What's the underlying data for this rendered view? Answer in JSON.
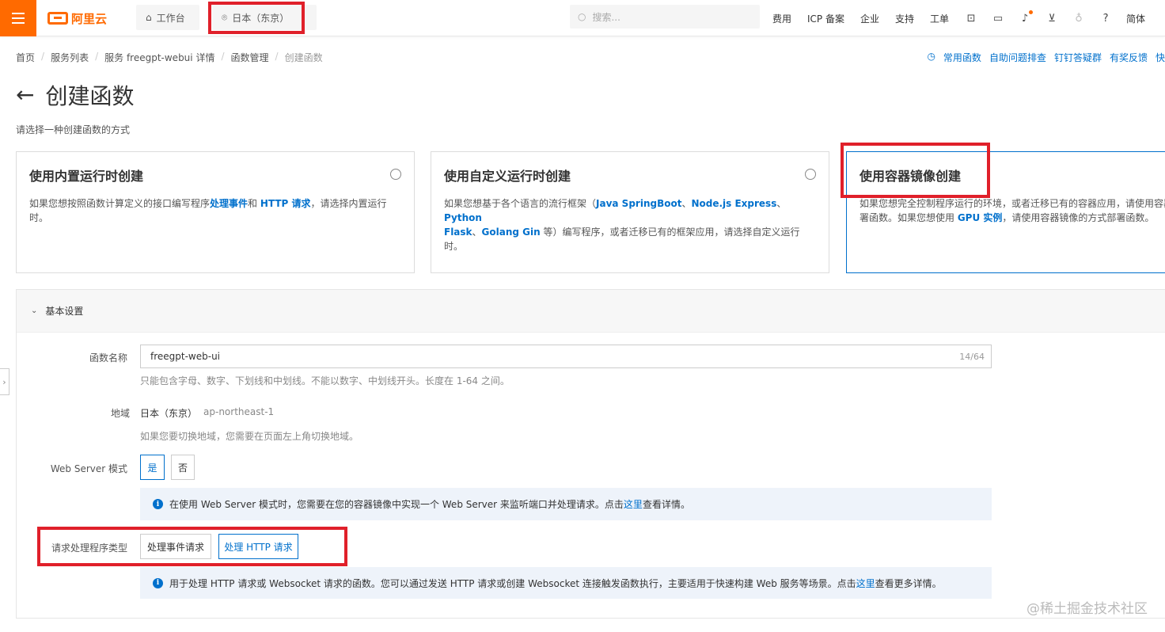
{
  "topbar": {
    "brand": "阿里云",
    "workbench": "工作台",
    "region": "日本（东京）",
    "search_placeholder": "搜索...",
    "nav": [
      "费用",
      "ICP 备案",
      "企业",
      "支持",
      "工单"
    ],
    "lang": "简体"
  },
  "breadcrumb": [
    "首页",
    "服务列表",
    "服务 freegpt-webui 详情",
    "函数管理",
    "创建函数"
  ],
  "help_links": [
    "常用函数",
    "自助问题排查",
    "钉钉答疑群",
    "有奖反馈",
    "快"
  ],
  "page": {
    "title": "创建函数",
    "subtitle": "请选择一种创建函数的方式"
  },
  "cards": [
    {
      "title": "使用内置运行时创建",
      "desc_parts": [
        "如果您想按照函数计算定义的接口编写程序",
        "处理事件",
        "和 ",
        "HTTP 请求",
        "，请选择内置运行时。"
      ]
    },
    {
      "title": "使用自定义运行时创建",
      "desc_line1_parts": [
        "如果您想基于各个语言的流行框架（",
        "Java SpringBoot",
        "、",
        "Node.js Express",
        "、",
        "Python"
      ],
      "desc_line2_parts": [
        "Flask",
        "、",
        "Golang Gin",
        " 等）编写程序，或者迁移已有的框架应用，请选择自定义运行时。"
      ]
    },
    {
      "title": "使用容器镜像创建",
      "desc_line1": "如果您想完全控制程序运行的环境，或者迁移已有的容器应用，请使用容器",
      "desc_line2_parts": [
        "署函数。如果您想使用 ",
        "GPU 实例",
        "，请使用容器镜像的方式部署函数。"
      ]
    }
  ],
  "section": {
    "title": "基本设置",
    "fn_name_label": "函数名称",
    "fn_name_value": "freegpt-web-ui",
    "fn_name_count": "14/64",
    "fn_name_hint": "只能包含字母、数字、下划线和中划线。不能以数字、中划线开头。长度在 1-64 之间。",
    "region_label": "地域",
    "region_value": "日本（东京）",
    "region_code": "ap-northeast-1",
    "region_hint": "如果您要切换地域，您需要在页面左上角切换地域。",
    "webserver_label": "Web Server 模式",
    "webserver_yes": "是",
    "webserver_no": "否",
    "webserver_info": "在使用 Web Server 模式时，您需要在您的容器镜像中实现一个 Web Server 来监听端口并处理请求。点击",
    "webserver_info_link": "这里",
    "webserver_info_tail": "查看详情。",
    "handler_label": "请求处理程序类型",
    "handler_event": "处理事件请求",
    "handler_http": "处理 HTTP 请求",
    "handler_info": "用于处理 HTTP 请求或 Websocket 请求的函数。您可以通过发送 HTTP 请求或创建 Websocket 连接触发函数执行，主要适用于快速构建 Web 服务等场景。点击",
    "handler_info_link": "这里",
    "handler_info_tail": "查看更多详情。"
  },
  "watermark": "@稀土掘金技术社区",
  "colors": {
    "brand": "#ff6a00",
    "accent": "#0070cc",
    "highlight": "#e0202a"
  }
}
